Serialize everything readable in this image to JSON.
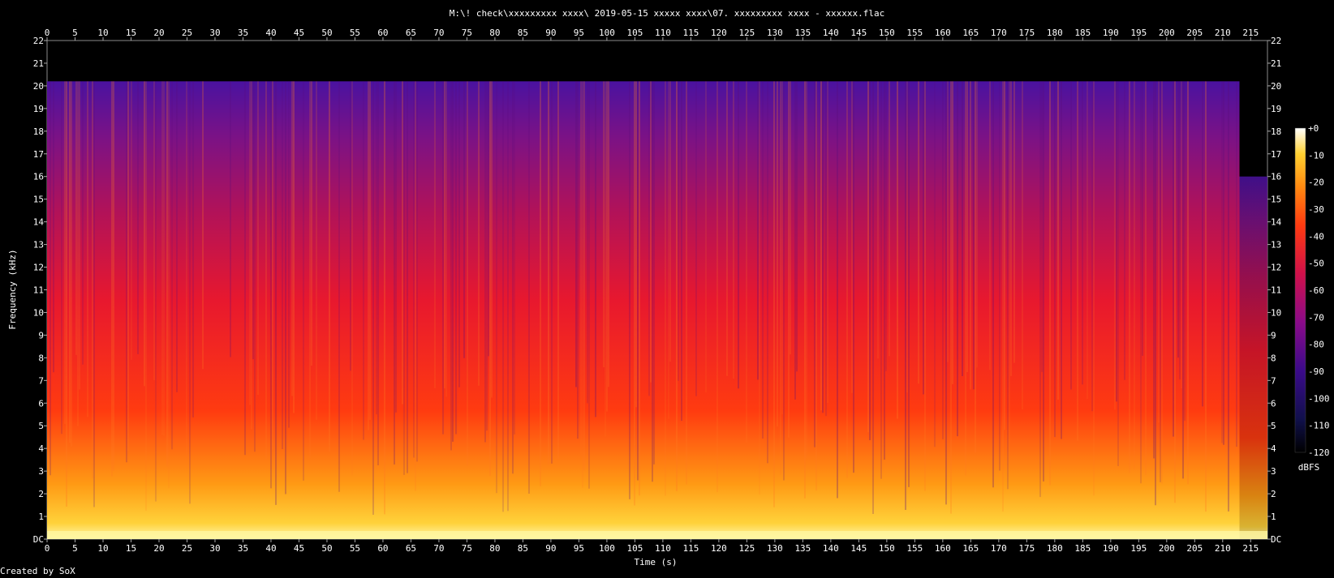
{
  "chart_data": {
    "type": "heatmap",
    "title": "M:\\! check\\xxxxxxxxx xxxx\\ 2019-05-15  xxxxx xxxx\\07. xxxxxxxxx xxxx - xxxxxx.flac",
    "xlabel": "Time (s)",
    "ylabel": "Frequency (kHz)",
    "xlim": [
      0,
      218
    ],
    "ylim": [
      0,
      22
    ],
    "x_ticks": [
      "0",
      "5",
      "10",
      "15",
      "20",
      "25",
      "30",
      "35",
      "40",
      "45",
      "50",
      "55",
      "60",
      "65",
      "70",
      "75",
      "80",
      "85",
      "90",
      "95",
      "100",
      "105",
      "110",
      "115",
      "120",
      "125",
      "130",
      "135",
      "140",
      "145",
      "150",
      "155",
      "160",
      "165",
      "170",
      "175",
      "180",
      "185",
      "190",
      "195",
      "200",
      "205",
      "210",
      "215"
    ],
    "y_ticks": [
      "DC",
      "1",
      "2",
      "3",
      "4",
      "5",
      "6",
      "7",
      "8",
      "9",
      "10",
      "11",
      "12",
      "13",
      "14",
      "15",
      "16",
      "17",
      "18",
      "19",
      "20",
      "21",
      "22"
    ],
    "colorbar": {
      "label": "dBFS",
      "ticks": [
        "+0",
        "-10",
        "-20",
        "-30",
        "-40",
        "-50",
        "-60",
        "-70",
        "-80",
        "-90",
        "-100",
        "-110",
        "-120"
      ],
      "range": [
        -120,
        0
      ]
    },
    "content_cutoff_khz": 20.2,
    "tail_cutoff_khz": 16.0,
    "tail_start_s": 213
  },
  "footer": {
    "credit": "Created by SoX"
  }
}
